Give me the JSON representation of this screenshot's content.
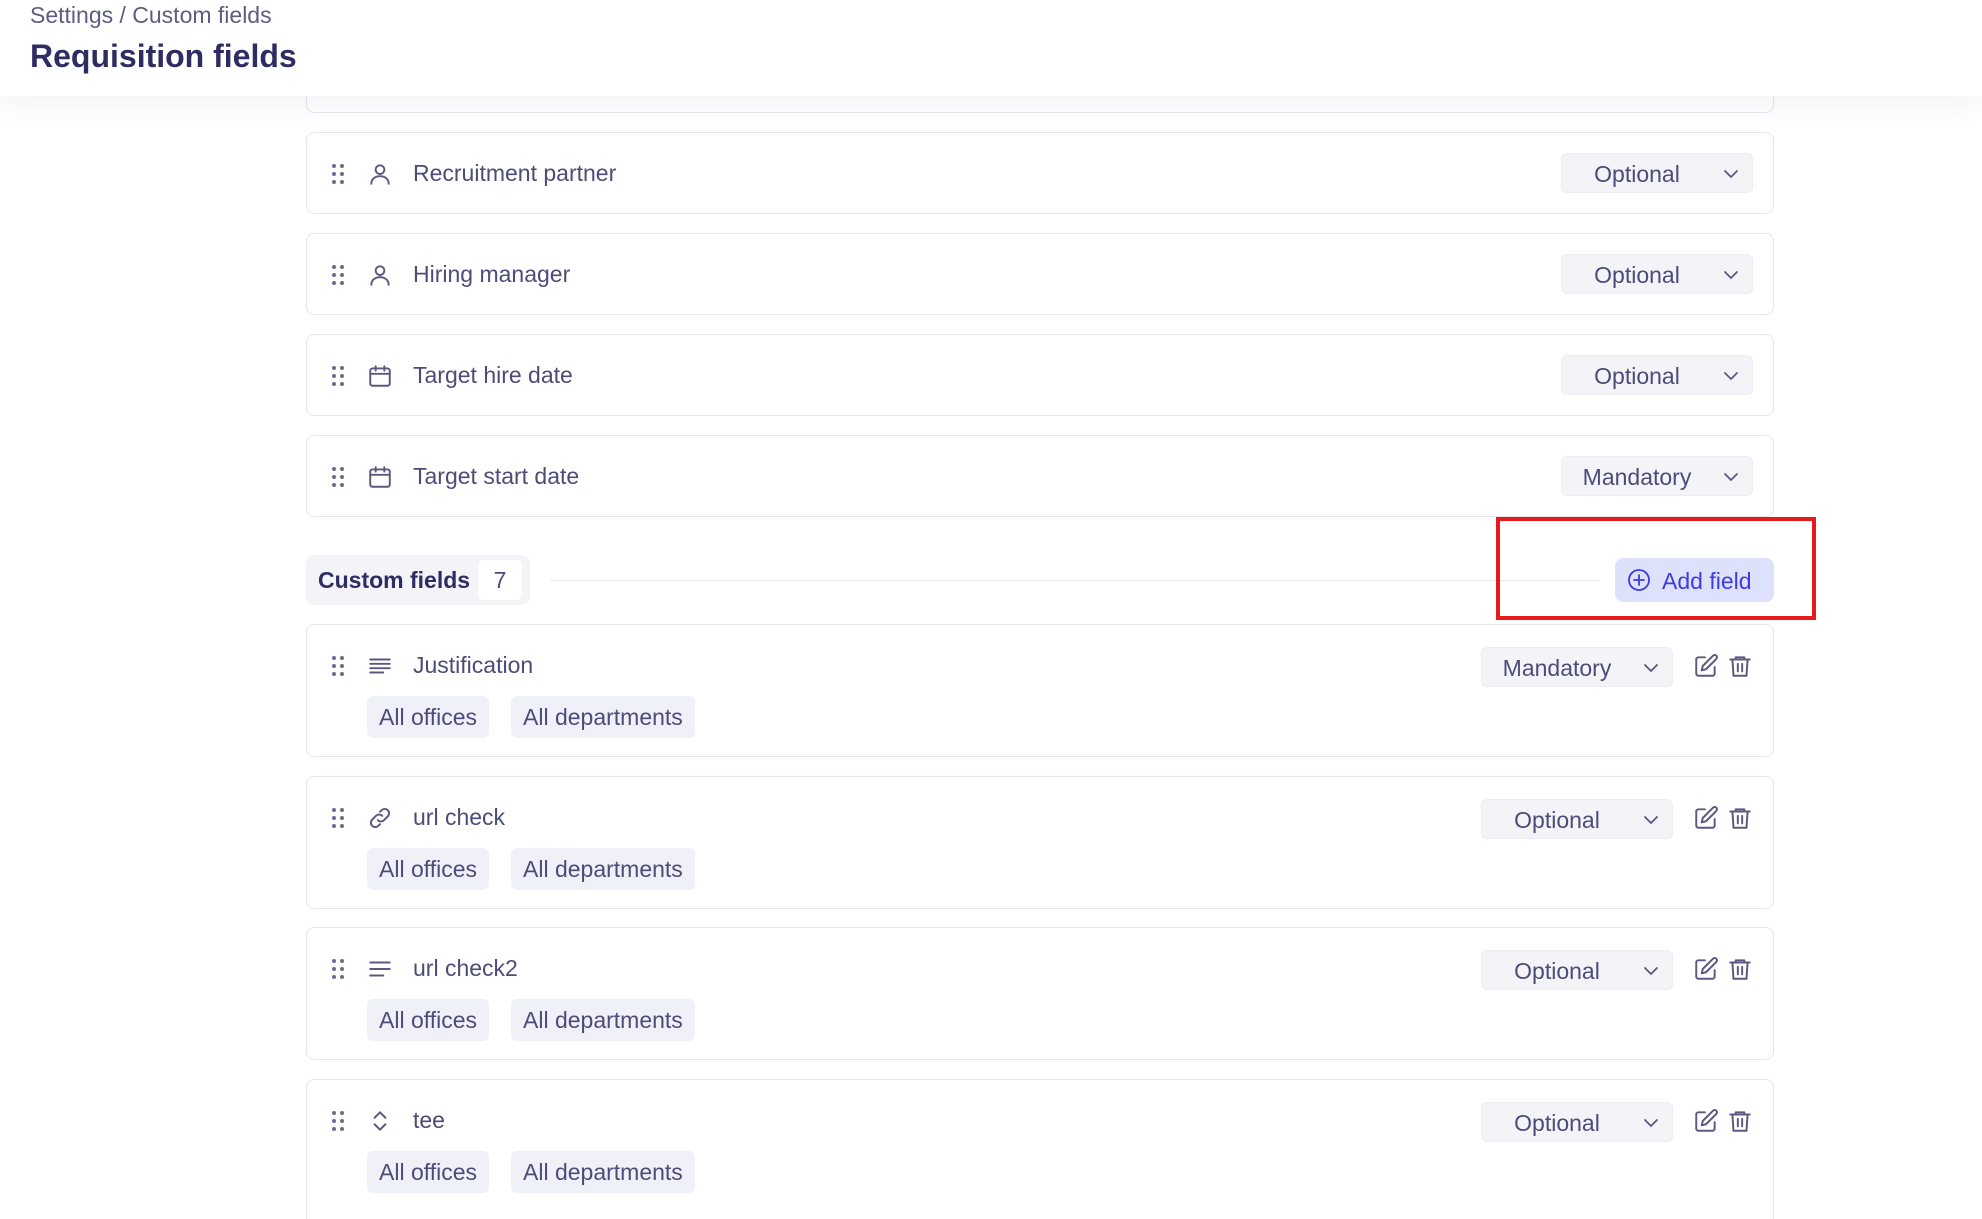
{
  "header": {
    "breadcrumb": "Settings / Custom fields",
    "title": "Requisition fields"
  },
  "standard_fields": [
    {
      "label": "Recruitment partner",
      "icon": "person-icon",
      "requirement": "Optional"
    },
    {
      "label": "Hiring manager",
      "icon": "person-icon",
      "requirement": "Optional"
    },
    {
      "label": "Target hire date",
      "icon": "calendar-icon",
      "requirement": "Optional"
    },
    {
      "label": "Target start date",
      "icon": "calendar-icon",
      "requirement": "Mandatory"
    }
  ],
  "custom_section": {
    "title": "Custom fields",
    "count": "7",
    "add_button_label": "Add field"
  },
  "custom_fields": [
    {
      "label": "Justification",
      "icon": "paragraph-icon",
      "requirement": "Mandatory",
      "offices": "All offices",
      "departments": "All departments"
    },
    {
      "label": "url check",
      "icon": "link-icon",
      "requirement": "Optional",
      "offices": "All offices",
      "departments": "All departments"
    },
    {
      "label": "url check2",
      "icon": "text-lines-icon",
      "requirement": "Optional",
      "offices": "All offices",
      "departments": "All departments"
    },
    {
      "label": "tee",
      "icon": "select-chevrons-icon",
      "requirement": "Optional",
      "offices": "All offices",
      "departments": "All departments"
    }
  ],
  "colors": {
    "title": "#2e2d63",
    "text": "#4c4c78",
    "accent": "#3c3ce0",
    "accent_bg": "#dde1fb",
    "highlight": "#e51b1b"
  }
}
